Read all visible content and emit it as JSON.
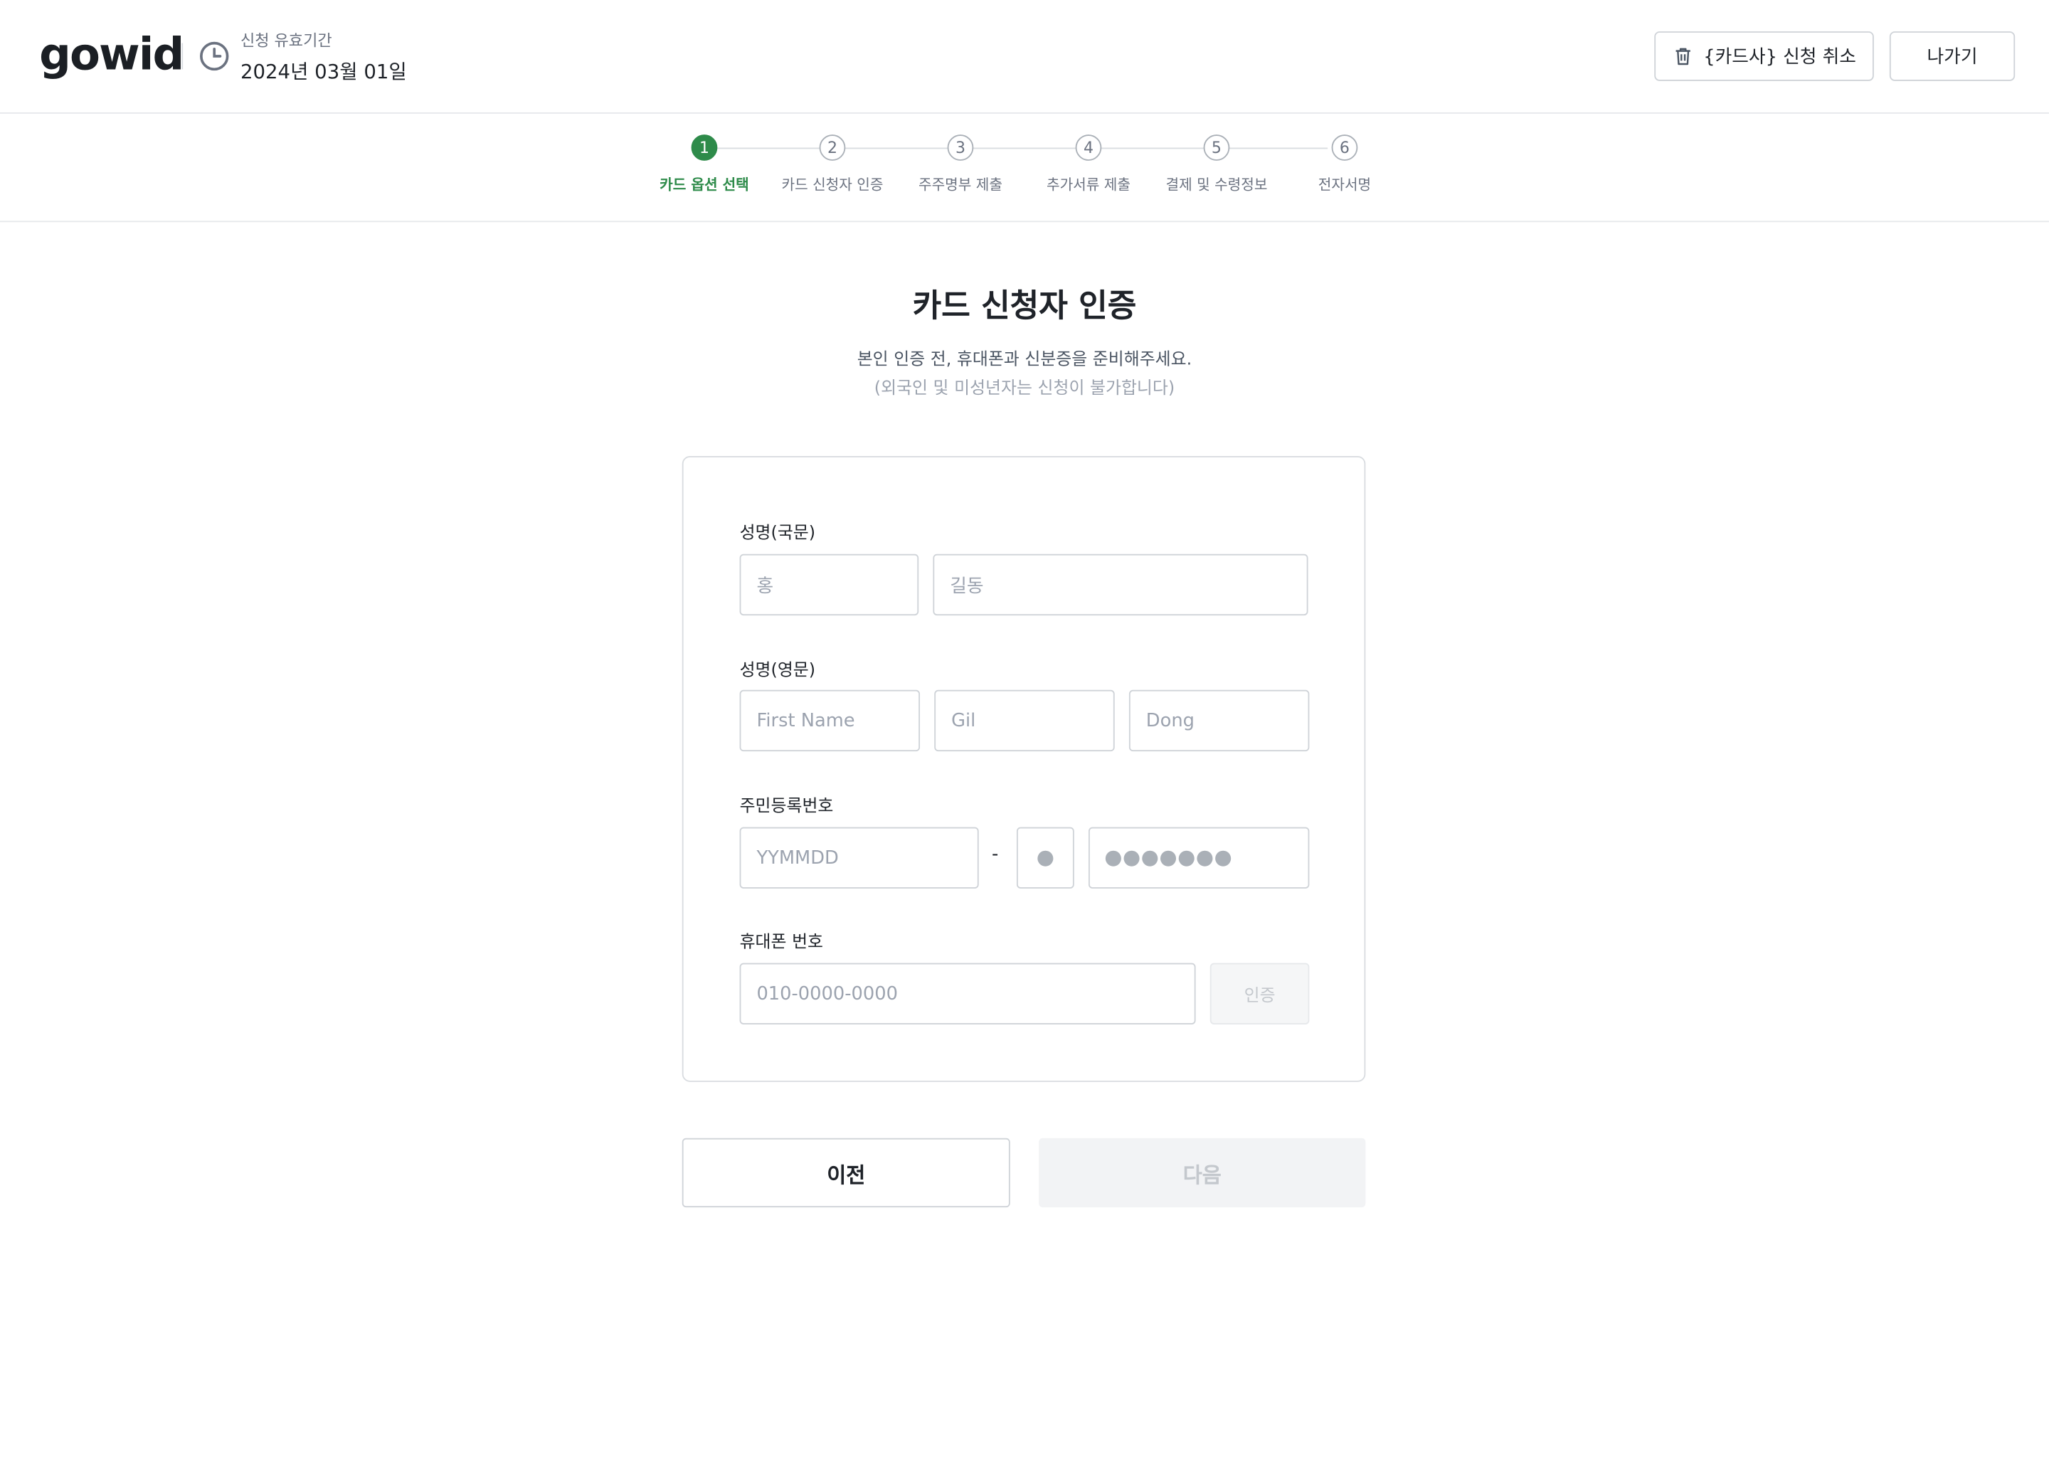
{
  "header": {
    "logo": "gowid",
    "validity_label": "신청 유효기간",
    "validity_date": "2024년 03월 01일",
    "cancel_label": "{카드사} 신청 취소",
    "exit_label": "나가기"
  },
  "steps": [
    {
      "num": "1",
      "label": "카드 옵션 선택",
      "active": true
    },
    {
      "num": "2",
      "label": "카드 신청자 인증",
      "active": false
    },
    {
      "num": "3",
      "label": "주주명부 제출",
      "active": false
    },
    {
      "num": "4",
      "label": "추가서류 제출",
      "active": false
    },
    {
      "num": "5",
      "label": "결제 및 수령정보",
      "active": false
    },
    {
      "num": "6",
      "label": "전자서명",
      "active": false
    }
  ],
  "page": {
    "title": "카드 신청자 인증",
    "subtitle": "본인 인증 전, 휴대폰과 신분증을 준비해주세요.",
    "note": "(외국인 및 미성년자는 신청이 불가합니다)"
  },
  "form": {
    "name_kr_label": "성명(국문)",
    "name_kr_last_placeholder": "홍",
    "name_kr_first_placeholder": "길동",
    "name_en_label": "성명(영문)",
    "name_en_first_placeholder": "First Name",
    "name_en_middle_placeholder": "Gil",
    "name_en_last_placeholder": "Dong",
    "rrn_label": "주민등록번호",
    "rrn_front_placeholder": "YYMMDD",
    "rrn_separator": "-",
    "phone_label": "휴대폰 번호",
    "phone_placeholder": "010-0000-0000",
    "verify_label": "인증"
  },
  "footer": {
    "prev_label": "이전",
    "next_label": "다음"
  },
  "colors": {
    "accent": "#2e8b4a",
    "border": "#cfd3d8",
    "muted_text": "#9ca3af",
    "disabled_bg": "#f2f3f5"
  }
}
